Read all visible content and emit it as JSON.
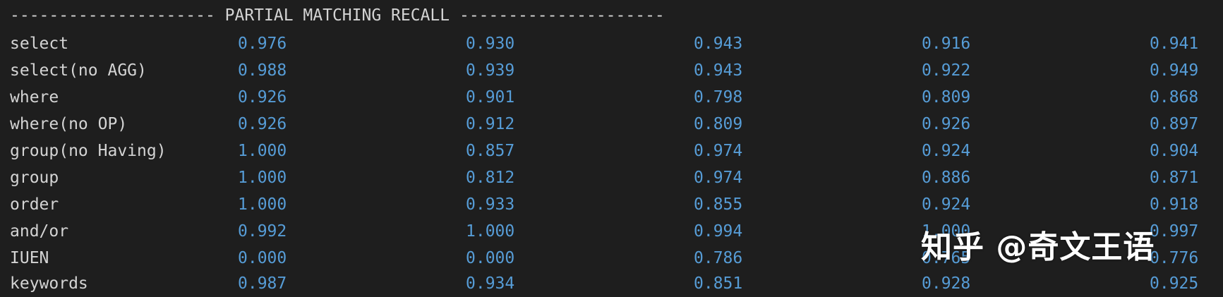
{
  "colors": {
    "background": "#1e1e1e",
    "label_text": "#d4d4d4",
    "number_text": "#569cd6",
    "watermark": "#ffffff"
  },
  "header": "--------------------- PARTIAL MATCHING RECALL ---------------------",
  "rows": [
    {
      "label": "select",
      "values": [
        "0.976",
        "0.930",
        "0.943",
        "0.916",
        "0.941"
      ]
    },
    {
      "label": "select(no AGG)",
      "values": [
        "0.988",
        "0.939",
        "0.943",
        "0.922",
        "0.949"
      ]
    },
    {
      "label": "where",
      "values": [
        "0.926",
        "0.901",
        "0.798",
        "0.809",
        "0.868"
      ]
    },
    {
      "label": "where(no OP)",
      "values": [
        "0.926",
        "0.912",
        "0.809",
        "0.926",
        "0.897"
      ]
    },
    {
      "label": "group(no Having)",
      "values": [
        "1.000",
        "0.857",
        "0.974",
        "0.924",
        "0.904"
      ]
    },
    {
      "label": "group",
      "values": [
        "1.000",
        "0.812",
        "0.974",
        "0.886",
        "0.871"
      ]
    },
    {
      "label": "order",
      "values": [
        "1.000",
        "0.933",
        "0.855",
        "0.924",
        "0.918"
      ]
    },
    {
      "label": "and/or",
      "values": [
        "0.992",
        "1.000",
        "0.994",
        "1.000",
        "0.997"
      ]
    },
    {
      "label": "IUEN",
      "values": [
        "0.000",
        "0.000",
        "0.786",
        "0.765",
        "0.776"
      ]
    },
    {
      "label": "keywords",
      "values": [
        "0.987",
        "0.934",
        "0.851",
        "0.928",
        "0.925"
      ]
    }
  ],
  "watermark": "知乎 @奇文王语"
}
